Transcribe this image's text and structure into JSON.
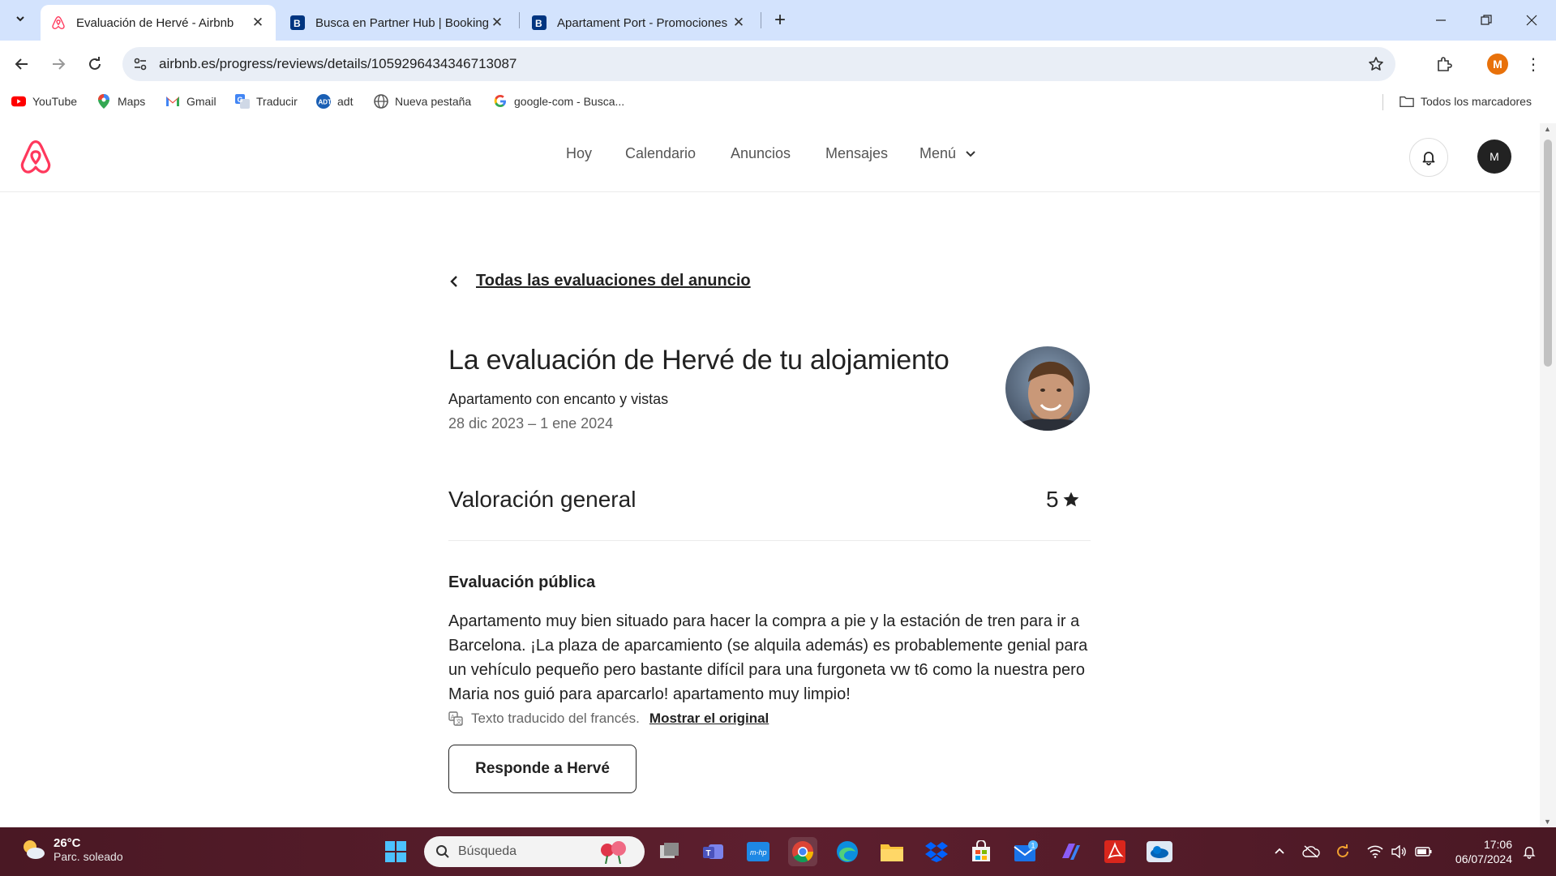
{
  "browser": {
    "tabs": [
      {
        "title": "Evaluación de Hervé - Airbnb",
        "active": true
      },
      {
        "title": "Busca en Partner Hub | Booking",
        "active": false
      },
      {
        "title": "Apartament Port - Promociones",
        "active": false
      }
    ],
    "url": "airbnb.es/progress/reviews/details/1059296434346713087",
    "profile_initial": "M",
    "bookmarks": [
      {
        "label": "YouTube",
        "icon": "youtube-icon"
      },
      {
        "label": "Maps",
        "icon": "maps-icon"
      },
      {
        "label": "Gmail",
        "icon": "gmail-icon"
      },
      {
        "label": "Traducir",
        "icon": "translate-icon"
      },
      {
        "label": "adt",
        "icon": "adt-icon"
      },
      {
        "label": "Nueva pestaña",
        "icon": "globe-icon"
      },
      {
        "label": "google-com - Busca...",
        "icon": "google-icon"
      }
    ],
    "all_bookmarks": "Todos los marcadores"
  },
  "header": {
    "nav": [
      "Hoy",
      "Calendario",
      "Anuncios",
      "Mensajes",
      "Menú"
    ],
    "avatar_initial": "M",
    "brand_color": "#ff385c"
  },
  "page": {
    "back_link": "Todas las evaluaciones del anuncio",
    "title": "La evaluación de Hervé de tu alojamiento",
    "listing": "Apartamento con encanto y vistas",
    "dates": "28 dic 2023 – 1 ene 2024",
    "overall_label": "Valoración general",
    "overall_score": "5",
    "public_heading": "Evaluación pública",
    "review_text": "Apartamento muy bien situado para hacer la compra a pie y la estación de tren para ir a Barcelona. ¡La plaza de aparcamiento (se alquila además) es probablemente genial para un vehículo pequeño pero bastante difícil para una furgoneta vw t6 como la nuestra pero Maria nos guió para aparcarlo! apartamento muy limpio!",
    "translated_note": "Texto traducido del francés.",
    "show_original": "Mostrar el original",
    "respond_button": "Responde a Hervé"
  },
  "taskbar": {
    "weather_temp": "26°C",
    "weather_desc": "Parc. soleado",
    "search_placeholder": "Búsqueda",
    "time": "17:06",
    "date": "06/07/2024",
    "mail_badge": "1"
  }
}
